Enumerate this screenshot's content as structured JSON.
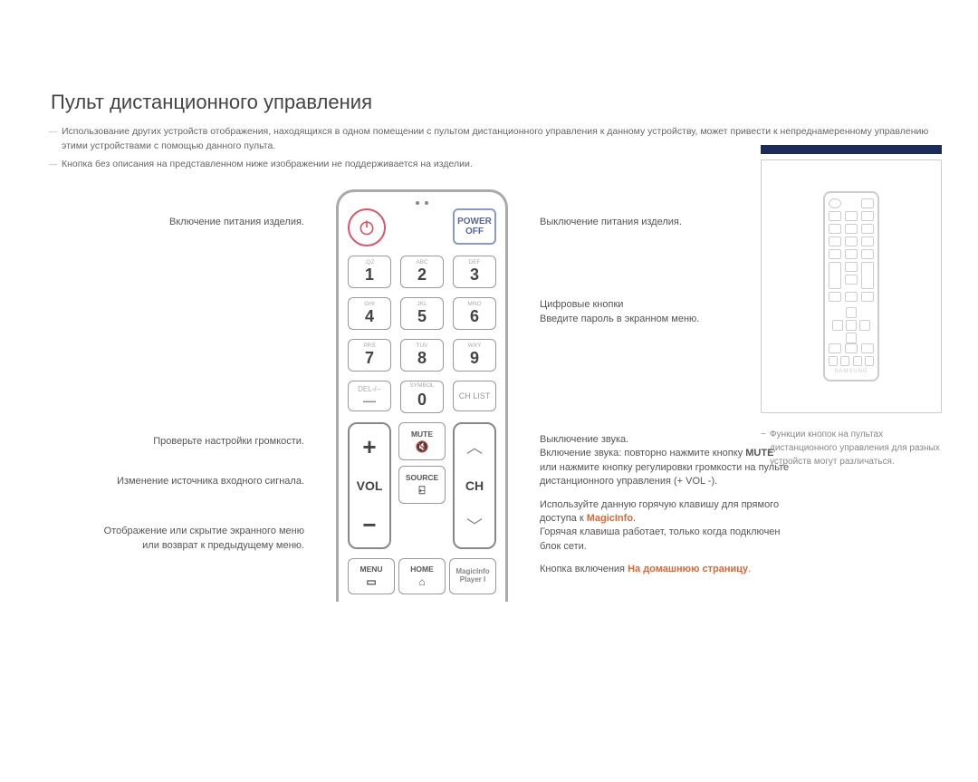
{
  "title": "Пульт дистанционного управления",
  "intro": {
    "p1": "Использование других устройств отображения, находящихся в одном помещении с пультом дистанционного управления к данному устройству, может привести к непреднамеренному управлению этими устройствами с помощью данного пульта.",
    "p2": "Кнопка без описания на представленном ниже изображении не поддерживается на изделии."
  },
  "left": {
    "power_on": "Включение питания изделия.",
    "volume": "Проверьте настройки громкости.",
    "source": "Изменение источника входного сигнала.",
    "menu1": "Отображение или скрытие экранного меню",
    "menu2": "или возврат к предыдущему меню."
  },
  "right": {
    "power_off": "Выключение питания изделия.",
    "num1": "Цифровые кнопки",
    "num2": "Введите пароль в экранном меню.",
    "mute1": "Выключение звука.",
    "mute2": "Включение звука: повторно нажмите кнопку ",
    "mute2b": "MUTE",
    "mute2c": " или нажмите кнопку регулировки громкости на пульте дистанционного управления (+ VOL -).",
    "magic1": "Используйте данную горячую клавишу для прямого доступа к ",
    "magic1b": "MagicInfo",
    "magic1c": ".",
    "magic2": "Горячая клавиша работает, только когда подключен блок сети.",
    "home1": "Кнопка включения ",
    "home1b": "На домашнюю страницу",
    "home1c": "."
  },
  "remote": {
    "power_off": "POWER OFF",
    "keys": {
      "1": {
        "sub": ".QZ",
        "n": "1"
      },
      "2": {
        "sub": "ABC",
        "n": "2"
      },
      "3": {
        "sub": "DEF",
        "n": "3"
      },
      "4": {
        "sub": "GHI",
        "n": "4"
      },
      "5": {
        "sub": "JKL",
        "n": "5"
      },
      "6": {
        "sub": "MNO",
        "n": "6"
      },
      "7": {
        "sub": "PRS",
        "n": "7"
      },
      "8": {
        "sub": "TUV",
        "n": "8"
      },
      "9": {
        "sub": "WXY",
        "n": "9"
      },
      "del": "DEL-/--",
      "sym": "SYMBOL",
      "0": "0",
      "chlist": "CH LIST"
    },
    "vol": "VOL",
    "ch": "CH",
    "mute": "MUTE",
    "source": "SOURCE",
    "menu": "MENU",
    "home": "HOME",
    "magic": "MagicInfo Player I"
  },
  "sidebar": {
    "note": "Функции кнопок на пультах дистанционного управления для разных устройств могут различаться.",
    "brand": "SAMSUNG"
  }
}
